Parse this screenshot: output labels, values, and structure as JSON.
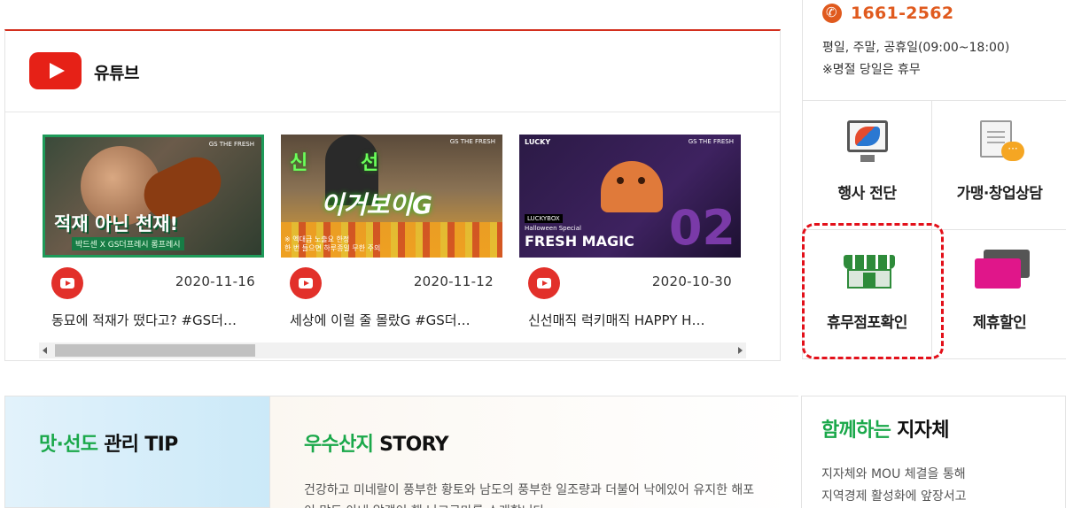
{
  "youtube": {
    "title": "유튜브",
    "videos": [
      {
        "date": "2020-11-16",
        "title": "동묘에 적재가 떴다고? #GS더…",
        "thumb": {
          "caption": "적재 아닌 천재!",
          "sub": "박드센 X GS더프레시 롱프레시",
          "brand": "GS THE FRESH"
        }
      },
      {
        "date": "2020-11-12",
        "title": "세상에 이럴 줄 몰랐G #GS더…",
        "thumb": {
          "caption_a": "신",
          "caption_b": "선",
          "caption_main": "이거보이G",
          "sub": "※ 엑대급 노출요 한정\n한 번 들으면 하루종일 무한 주의",
          "brand": "GS THE FRESH"
        }
      },
      {
        "date": "2020-10-30",
        "title": "신선매직 럭키매직 HAPPY H…",
        "thumb": {
          "lucky": "LUCKY",
          "box": "LUCKYBOX",
          "special": "Halloween Special",
          "magic": "FRESH MAGIC",
          "number": "02",
          "brand": "GS THE FRESH"
        }
      }
    ]
  },
  "contact": {
    "phone": "1661-2562",
    "hours": "평일, 주말, 공휴일(09:00~18:00)",
    "note": "※명절 당일은 휴무"
  },
  "menu": {
    "items": [
      {
        "label": "행사 전단",
        "icon": "flyer-monitor-icon"
      },
      {
        "label": "가맹·창업상담",
        "icon": "consult-document-icon"
      },
      {
        "label": "휴무점포확인",
        "icon": "store-icon"
      },
      {
        "label": "제휴할인",
        "icon": "discount-card-icon"
      }
    ]
  },
  "bottom": {
    "tip": {
      "title_a": "맛·선도",
      "title_b": " 관리 TIP"
    },
    "story": {
      "title_a": "우수산지",
      "title_b": " STORY",
      "text": "건강하고 미네랄이 풍부한 황토와 남도의 풍부한 일조량과 더불어 낙에있어 유지한 해포이 많도 아내 알갯이 핸 난고구마를 소개합니다"
    },
    "municipality": {
      "title_a": "함께하는",
      "title_b": " 지자체",
      "line1": "지자체와 MOU 체결을 통해",
      "line2": "지역경제 활성화에 앞장서고"
    }
  },
  "colors": {
    "accent_red": "#d32f1e",
    "phone_orange": "#e05a1e",
    "green": "#1aa84a",
    "highlight_dashed": "#e3101a"
  }
}
